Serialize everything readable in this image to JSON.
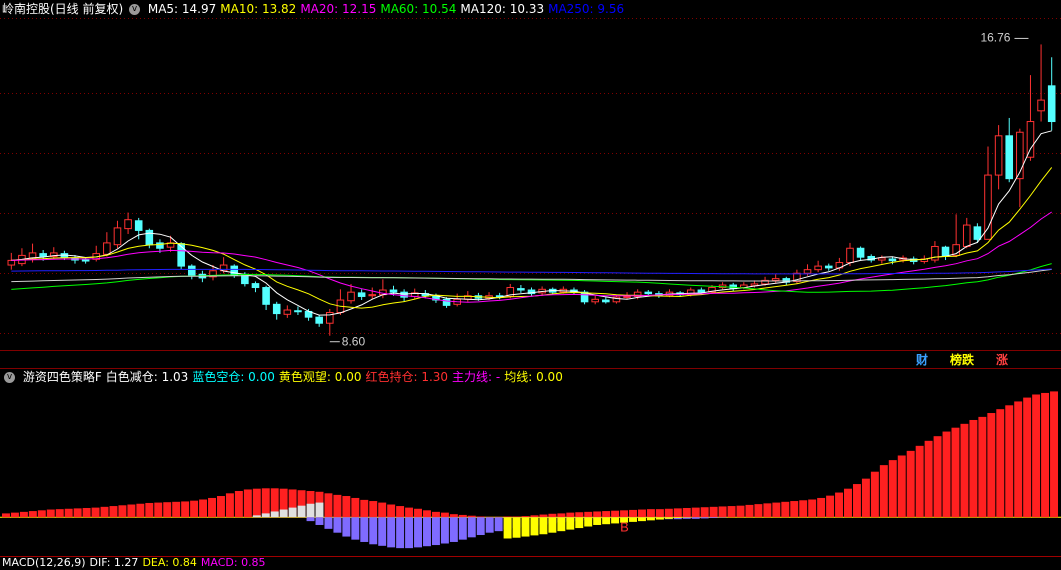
{
  "main_header": {
    "title": "岭南控股(日线 前复权)",
    "toggle_glyph": "v",
    "ma": [
      {
        "label": "MA5: 14.97",
        "color": "#ffffff"
      },
      {
        "label": "MA10: 13.82",
        "color": "#ffff00"
      },
      {
        "label": "MA20: 12.15",
        "color": "#ff00ff"
      },
      {
        "label": "MA60: 10.54",
        "color": "#00ff00"
      },
      {
        "label": "MA120: 10.33",
        "color": "#ffffff"
      },
      {
        "label": "MA250: 9.56",
        "color": "#0000ff"
      }
    ]
  },
  "indicator_header": {
    "toggle_glyph": "v",
    "items": [
      {
        "label": "游资四色策略F",
        "color": "#ffffff"
      },
      {
        "label": "白色减仓: 1.03",
        "color": "#ffffff"
      },
      {
        "label": "蓝色空仓: 0.00",
        "color": "#00ffff"
      },
      {
        "label": "黄色观望: 0.00",
        "color": "#ffff00"
      },
      {
        "label": "红色持仓: 1.30",
        "color": "#ff3030"
      },
      {
        "label": "主力线: -",
        "color": "#ff00ff"
      },
      {
        "label": "均线: 0.00",
        "color": "#ffff00"
      }
    ]
  },
  "macd_header": {
    "items": [
      {
        "label": "MACD(12,26,9)",
        "color": "#ffffff"
      },
      {
        "label": "DIF: 1.27",
        "color": "#ffffff"
      },
      {
        "label": "DEA: 0.84",
        "color": "#ffff00"
      },
      {
        "label": "MACD: 0.85",
        "color": "#ff00ff"
      }
    ]
  },
  "tags": [
    {
      "label": "财",
      "color": "#3aa0ff"
    },
    {
      "label": "榜跌",
      "color": "#ffff00"
    },
    {
      "label": "涨",
      "color": "#ff4040"
    }
  ],
  "colors": {
    "up": "#ff3232",
    "down": "#54ffff",
    "grid": "#800000",
    "axis": "#a00000"
  },
  "chart_data": [
    {
      "type": "candlestick",
      "title": "岭南控股(日线 前复权)",
      "annotations": [
        {
          "label": "16.76",
          "kind": "max",
          "value": 16.76,
          "bar": 96
        },
        {
          "label": "8.60",
          "kind": "min",
          "value": 8.6,
          "bar": 30
        }
      ],
      "ylim": [
        8.2,
        17.5
      ],
      "bars": [
        [
          10.58,
          10.71,
          10.92,
          10.45
        ],
        [
          10.62,
          10.85,
          11.05,
          10.55
        ],
        [
          10.78,
          10.92,
          11.18,
          10.65
        ],
        [
          10.9,
          10.82,
          11.0,
          10.7
        ],
        [
          10.82,
          10.92,
          11.08,
          10.75
        ],
        [
          10.9,
          10.8,
          10.98,
          10.72
        ],
        [
          10.78,
          10.72,
          10.86,
          10.62
        ],
        [
          10.72,
          10.7,
          10.8,
          10.62
        ],
        [
          10.74,
          10.9,
          11.12,
          10.68
        ],
        [
          10.88,
          11.2,
          11.5,
          10.82
        ],
        [
          11.15,
          11.62,
          11.82,
          11.05
        ],
        [
          11.6,
          11.85,
          12.05,
          11.45
        ],
        [
          11.82,
          11.55,
          11.9,
          11.3
        ],
        [
          11.55,
          11.15,
          11.6,
          11.05
        ],
        [
          11.2,
          11.05,
          11.3,
          10.92
        ],
        [
          11.08,
          11.2,
          11.4,
          10.95
        ],
        [
          11.18,
          10.55,
          11.22,
          10.45
        ],
        [
          10.55,
          10.3,
          10.6,
          10.18
        ],
        [
          10.32,
          10.22,
          10.42,
          10.1
        ],
        [
          10.25,
          10.42,
          10.58,
          10.15
        ],
        [
          10.42,
          10.58,
          10.8,
          10.35
        ],
        [
          10.55,
          10.3,
          10.6,
          10.22
        ],
        [
          10.32,
          10.06,
          10.38,
          9.98
        ],
        [
          10.06,
          9.95,
          10.12,
          9.82
        ],
        [
          9.95,
          9.48,
          10.0,
          9.32
        ],
        [
          9.48,
          9.22,
          9.55,
          9.05
        ],
        [
          9.2,
          9.32,
          9.45,
          9.1
        ],
        [
          9.3,
          9.28,
          9.42,
          9.18
        ],
        [
          9.28,
          9.12,
          9.35,
          9.02
        ],
        [
          9.12,
          8.95,
          9.18,
          8.85
        ],
        [
          8.95,
          9.25,
          9.35,
          8.6
        ],
        [
          9.25,
          9.6,
          9.9,
          9.18
        ],
        [
          9.58,
          9.82,
          10.05,
          9.5
        ],
        [
          9.8,
          9.7,
          9.9,
          9.6
        ],
        [
          9.72,
          9.75,
          9.95,
          9.62
        ],
        [
          9.75,
          9.88,
          10.18,
          9.65
        ],
        [
          9.88,
          9.82,
          10.0,
          9.72
        ],
        [
          9.82,
          9.68,
          9.9,
          9.55
        ],
        [
          9.7,
          9.8,
          9.92,
          9.62
        ],
        [
          9.78,
          9.72,
          9.88,
          9.65
        ],
        [
          9.72,
          9.6,
          9.78,
          9.52
        ],
        [
          9.62,
          9.45,
          9.68,
          9.38
        ],
        [
          9.48,
          9.62,
          9.78,
          9.42
        ],
        [
          9.62,
          9.72,
          9.85,
          9.55
        ],
        [
          9.72,
          9.65,
          9.8,
          9.58
        ],
        [
          9.65,
          9.72,
          9.82,
          9.6
        ],
        [
          9.72,
          9.68,
          9.8,
          9.62
        ],
        [
          9.7,
          9.95,
          10.05,
          9.65
        ],
        [
          9.92,
          9.88,
          10.02,
          9.8
        ],
        [
          9.88,
          9.78,
          9.95,
          9.72
        ],
        [
          9.8,
          9.9,
          9.98,
          9.72
        ],
        [
          9.9,
          9.82,
          9.95,
          9.75
        ],
        [
          9.82,
          9.9,
          9.98,
          9.78
        ],
        [
          9.88,
          9.82,
          9.95,
          9.75
        ],
        [
          9.82,
          9.55,
          9.88,
          9.48
        ],
        [
          9.55,
          9.62,
          9.72,
          9.48
        ],
        [
          9.6,
          9.55,
          9.68,
          9.5
        ],
        [
          9.55,
          9.68,
          9.75,
          9.5
        ],
        [
          9.68,
          9.7,
          9.82,
          9.62
        ],
        [
          9.7,
          9.82,
          9.9,
          9.62
        ],
        [
          9.82,
          9.78,
          9.88,
          9.7
        ],
        [
          9.78,
          9.72,
          9.85,
          9.66
        ],
        [
          9.72,
          9.82,
          9.9,
          9.68
        ],
        [
          9.8,
          9.75,
          9.85,
          9.7
        ],
        [
          9.75,
          9.88,
          9.95,
          9.7
        ],
        [
          9.88,
          9.82,
          9.95,
          9.75
        ],
        [
          9.82,
          9.95,
          10.02,
          9.78
        ],
        [
          9.95,
          10.02,
          10.1,
          9.9
        ],
        [
          10.02,
          9.92,
          10.08,
          9.85
        ],
        [
          9.95,
          10.02,
          10.1,
          9.9
        ],
        [
          10.0,
          10.05,
          10.15,
          9.95
        ],
        [
          10.05,
          10.15,
          10.25,
          10.0
        ],
        [
          10.15,
          10.2,
          10.32,
          10.08
        ],
        [
          10.2,
          10.1,
          10.25,
          10.02
        ],
        [
          10.12,
          10.35,
          10.45,
          10.05
        ],
        [
          10.35,
          10.45,
          10.6,
          10.28
        ],
        [
          10.45,
          10.55,
          10.7,
          10.38
        ],
        [
          10.55,
          10.5,
          10.62,
          10.42
        ],
        [
          10.5,
          10.65,
          10.78,
          10.42
        ],
        [
          10.65,
          11.05,
          11.2,
          10.55
        ],
        [
          11.05,
          10.8,
          11.1,
          10.72
        ],
        [
          10.82,
          10.72,
          10.88,
          10.65
        ],
        [
          10.72,
          10.78,
          10.85,
          10.62
        ],
        [
          10.75,
          10.7,
          10.82,
          10.6
        ],
        [
          10.72,
          10.78,
          10.85,
          10.65
        ],
        [
          10.75,
          10.68,
          10.82,
          10.6
        ],
        [
          10.68,
          10.75,
          10.85,
          10.62
        ],
        [
          10.72,
          11.1,
          11.25,
          10.65
        ],
        [
          11.08,
          10.82,
          11.12,
          10.72
        ],
        [
          10.85,
          11.15,
          12.0,
          10.8
        ],
        [
          11.1,
          11.7,
          11.9,
          11.05
        ],
        [
          11.65,
          11.3,
          11.75,
          11.2
        ],
        [
          11.3,
          13.1,
          13.9,
          11.3
        ],
        [
          13.1,
          14.2,
          14.5,
          12.7
        ],
        [
          14.2,
          13.0,
          14.7,
          12.9
        ],
        [
          13.0,
          14.3,
          14.4,
          12.2
        ],
        [
          13.6,
          14.6,
          15.9,
          13.5
        ],
        [
          14.9,
          15.2,
          16.76,
          14.6
        ],
        [
          15.6,
          14.6,
          16.4,
          14.35
        ]
      ]
    },
    {
      "type": "bar",
      "title": "游资四色策略F",
      "annotations": [
        {
          "label": "B",
          "bar": 69
        }
      ],
      "ylim": [
        -0.9,
        3.4
      ],
      "series": [
        {
          "name": "红色持仓",
          "color": "#ff2020",
          "values": [
            0.1,
            0.12,
            0.14,
            0.16,
            0.18,
            0.2,
            0.21,
            0.22,
            0.23,
            0.24,
            0.25,
            0.27,
            0.29,
            0.31,
            0.33,
            0.35,
            0.37,
            0.38,
            0.39,
            0.4,
            0.41,
            0.43,
            0.46,
            0.5,
            0.55,
            0.62,
            0.68,
            0.72,
            0.74,
            0.75,
            0.75,
            0.74,
            0.72,
            0.7,
            0.68,
            0.66,
            0.62,
            0.58,
            0.55,
            0.5,
            0.45,
            0.42,
            0.38,
            0.33,
            0.29,
            0.25,
            0.22,
            0.18,
            0.14,
            0.12,
            0.08,
            0.06,
            0.04,
            0.02,
            0.01,
            0.01,
            0.02,
            0.02,
            0.03,
            0.05,
            0.07,
            0.09,
            0.1,
            0.12,
            0.13,
            0.14,
            0.15,
            0.16,
            0.17,
            0.18,
            0.19,
            0.2,
            0.21,
            0.21,
            0.22,
            0.23,
            0.24,
            0.25,
            0.26,
            0.27,
            0.28,
            0.29,
            0.3,
            0.32,
            0.34,
            0.36,
            0.38,
            0.4,
            0.42,
            0.44,
            0.46,
            0.5,
            0.56,
            0.64,
            0.74,
            0.86,
            1.0,
            1.18,
            1.35,
            1.48,
            1.6,
            1.72,
            1.85,
            1.98,
            2.1,
            2.22,
            2.32,
            2.42,
            2.52,
            2.6,
            2.7,
            2.8,
            2.9,
            3.0,
            3.1,
            3.18,
            3.22,
            3.26
          ]
        },
        {
          "name": "白色减仓",
          "color": "#e0e0e0",
          "values": [
            0.05,
            0.1,
            0.15,
            0.2,
            0.25,
            0.3,
            0.35,
            0.38
          ]
        },
        {
          "name": "蓝色空仓",
          "color": "#7f6bff",
          "values": [
            -0.1,
            -0.2,
            -0.3,
            -0.4,
            -0.5,
            -0.58,
            -0.64,
            -0.7,
            -0.74,
            -0.78,
            -0.8,
            -0.8,
            -0.78,
            -0.75,
            -0.72,
            -0.68,
            -0.64,
            -0.58,
            -0.52,
            -0.46,
            -0.4,
            -0.36,
            -0.32,
            -0.28,
            -0.25,
            -0.22,
            -0.19,
            -0.16,
            -0.13,
            -0.11,
            -0.09,
            -0.07,
            -0.05,
            -0.04,
            -0.03,
            -0.02,
            -0.02,
            -0.03,
            -0.04,
            -0.05,
            -0.05,
            -0.05,
            -0.04,
            -0.04,
            -0.03,
            -0.02,
            -0.01
          ]
        },
        {
          "name": "黄色观望",
          "color": "#ffff00",
          "values": [
            -0.55,
            -0.53,
            -0.5,
            -0.47,
            -0.44,
            -0.4,
            -0.36,
            -0.32,
            -0.28,
            -0.24,
            -0.2,
            -0.18,
            -0.16,
            -0.14,
            -0.12,
            -0.1,
            -0.08,
            -0.06,
            -0.04,
            -0.02,
            -0.01
          ]
        }
      ]
    }
  ]
}
